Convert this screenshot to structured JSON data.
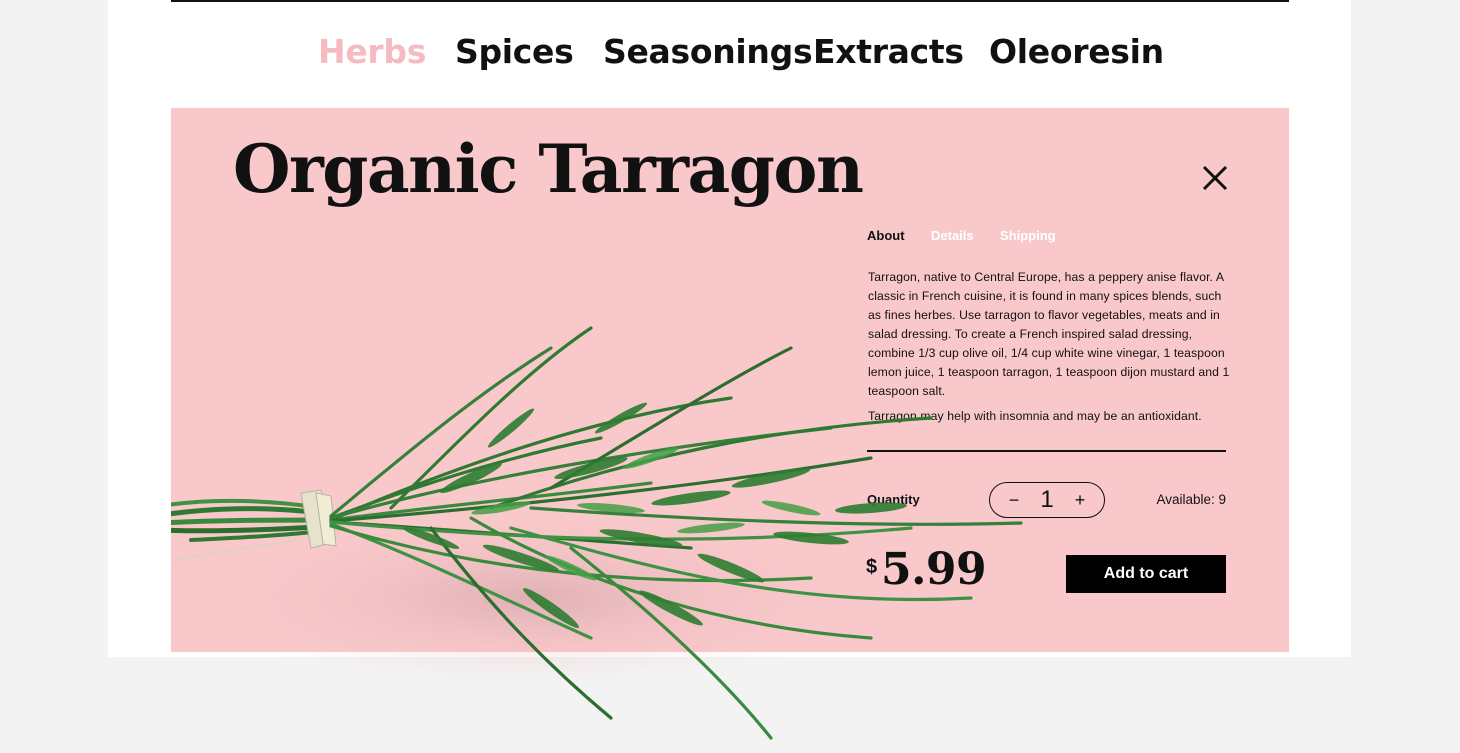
{
  "nav": {
    "categories": [
      {
        "label": "Herbs",
        "active": true
      },
      {
        "label": "Spices",
        "active": false
      },
      {
        "label": "Seasonings",
        "active": false
      },
      {
        "label": "Extracts",
        "active": false
      },
      {
        "label": "Oleoresin",
        "active": false
      }
    ]
  },
  "product": {
    "title": "Organic Tarragon",
    "tabs": [
      {
        "label": "About",
        "active": true
      },
      {
        "label": "Details",
        "active": false
      },
      {
        "label": "Shipping",
        "active": false
      }
    ],
    "description": [
      "Tarragon, native to Central Europe, has a peppery anise flavor. A classic in French cuisine, it is found in many spices blends, such as fines herbes. Use tarragon to flavor vegetables, meats and in salad dressing. To create a French inspired salad dressing, combine 1/3 cup olive oil, 1/4 cup white wine vinegar, 1 teaspoon lemon juice, 1 teaspoon tarragon, 1 teaspoon dijon mustard and 1 teaspoon salt.",
      "Tarragon may help with insomnia and may be an antioxidant."
    ],
    "quantity_label": "Quantity",
    "quantity_value": "1",
    "minus_symbol": "−",
    "plus_symbol": "+",
    "available": "Available: 9",
    "currency": "$",
    "price": "5.99",
    "add_to_cart": "Add to cart"
  },
  "icons": {
    "close": "close-icon",
    "product_image": "tarragon-bundle-image"
  },
  "colors": {
    "panel_bg": "#f9c8cb",
    "active_category": "#f4bcc2",
    "button_bg": "#000000"
  }
}
